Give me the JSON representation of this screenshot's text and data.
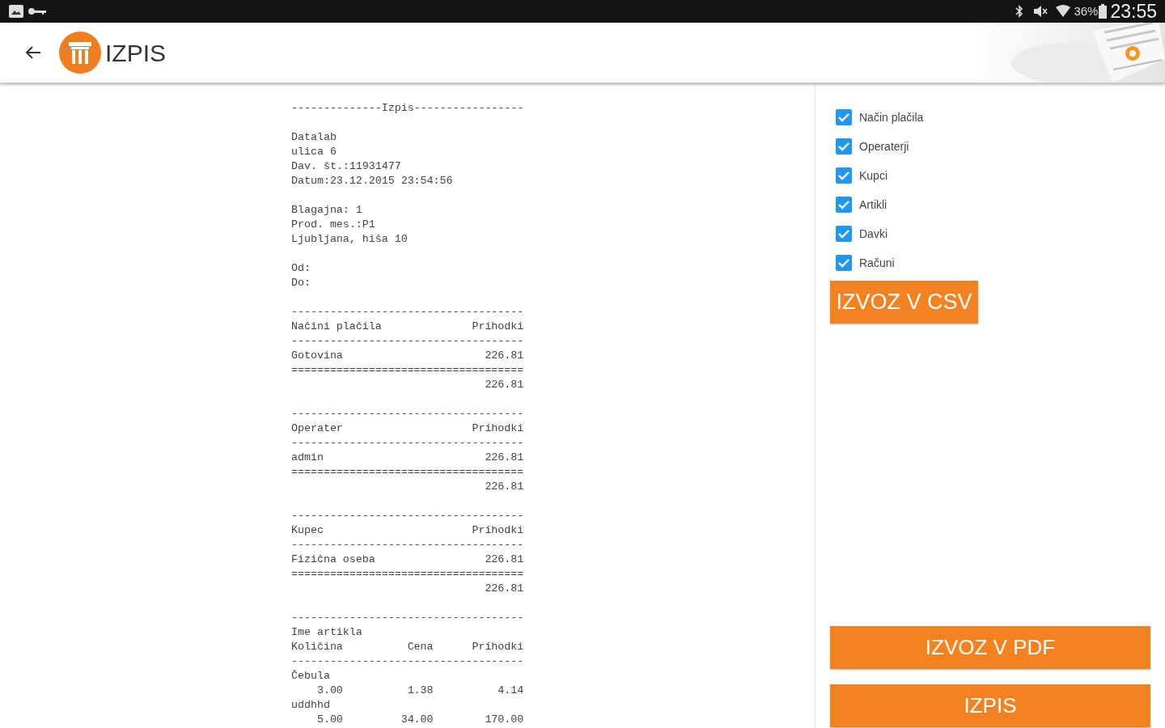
{
  "status_bar": {
    "battery": "36%",
    "time": "23:55"
  },
  "app_bar": {
    "title": "IZPIS"
  },
  "receipt": {
    "sections": [
      [
        "--------------Izpis-----------------"
      ],
      [
        "Datalab",
        "ulica 6",
        "Dav. št.:11931477",
        "Datum:23.12.2015 23:54:56"
      ],
      [
        "Blagajna: 1",
        "Prod. mes.:P1",
        "Ljubljana, hiša 10"
      ],
      [
        "Od:",
        "Do:"
      ],
      [
        "------------------------------------",
        "Načini plačila              Prihodki",
        "------------------------------------",
        "Gotovina                      226.81",
        "====================================",
        "                              226.81"
      ],
      [
        "------------------------------------",
        "Operater                    Prihodki",
        "------------------------------------",
        "admin                         226.81",
        "====================================",
        "                              226.81"
      ],
      [
        "------------------------------------",
        "Kupec                       Prihodki",
        "------------------------------------",
        "Fizična oseba                 226.81",
        "====================================",
        "                              226.81"
      ],
      [
        "------------------------------------",
        "Ime artikla",
        "Količina          Cena      Prihodki",
        "------------------------------------",
        "Čebula",
        "    3.00          1.38          4.14",
        "uddhhd",
        "    5.00         34.00        170.00"
      ]
    ]
  },
  "options": [
    {
      "label": "Način plačila",
      "checked": true
    },
    {
      "label": "Operaterji",
      "checked": true
    },
    {
      "label": "Kupci",
      "checked": true
    },
    {
      "label": "Artikli",
      "checked": true
    },
    {
      "label": "Davki",
      "checked": true
    },
    {
      "label": "Računi",
      "checked": true
    }
  ],
  "export_csv_button": "IZVOZ V CSV",
  "bottom_buttons": [
    "IZVOZ V PDF",
    "IZPIS"
  ]
}
